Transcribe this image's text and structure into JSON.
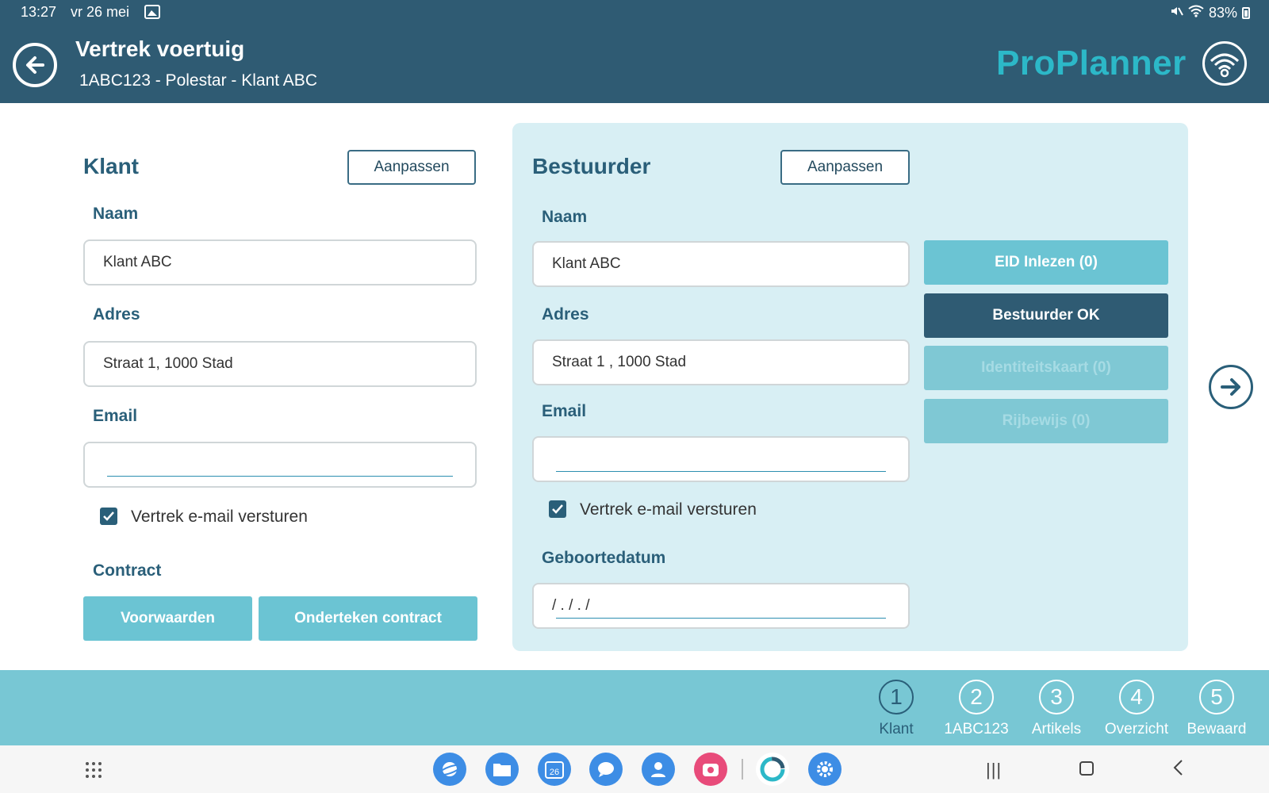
{
  "status_bar": {
    "time": "13:27",
    "date": "vr 26 mei",
    "battery": "83%"
  },
  "header": {
    "title": "Vertrek voertuig",
    "subtitle": "1ABC123 -  Polestar - Klant ABC",
    "logo": "ProPlanner",
    "logo_color": "#2cb8c8",
    "background": "#2f5b73"
  },
  "customer": {
    "title": "Klant",
    "edit_label": "Aanpassen",
    "name_label": "Naam",
    "name_value": "Klant ABC",
    "address_label": "Adres",
    "address_value": "Straat 1, 1000 Stad",
    "email_label": "Email",
    "email_value": "",
    "send_email_label": "Vertrek e-mail versturen",
    "send_email_checked": true,
    "contract_label": "Contract",
    "terms_button": "Voorwaarden",
    "sign_button": "Onderteken contract"
  },
  "driver": {
    "title": "Bestuurder",
    "edit_label": "Aanpassen",
    "name_label": "Naam",
    "name_value": "Klant ABC",
    "address_label": "Adres",
    "address_value": "Straat 1 , 1000 Stad",
    "email_label": "Email",
    "email_value": "",
    "send_email_label": "Vertrek e-mail versturen",
    "send_email_checked": true,
    "birthdate_label": "Geboortedatum",
    "birthdate_value": "/ . / . /",
    "eid_button": "EID Inlezen (0)",
    "ok_button": "Bestuurder OK",
    "id_card_button": "Identiteitskaart (0)",
    "license_button": "Rijbewijs (0)"
  },
  "steps": [
    {
      "number": "1",
      "label": "Klant",
      "active": true
    },
    {
      "number": "2",
      "label": "1ABC123",
      "active": false
    },
    {
      "number": "3",
      "label": "Artikels",
      "active": false
    },
    {
      "number": "4",
      "label": "Overzicht",
      "active": false
    },
    {
      "number": "5",
      "label": "Bewaard",
      "active": false
    }
  ],
  "nav_bar": {
    "calendar_day": "26",
    "apps": [
      "internet-icon",
      "files-icon",
      "calendar-icon",
      "messages-icon",
      "contacts-icon",
      "camera-icon",
      "proplanner-icon",
      "settings-icon"
    ]
  },
  "colors": {
    "accent": "#6bc4d3",
    "dark": "#2a5f79",
    "panel": "#d8eff4",
    "steps_bar": "#78c7d4"
  }
}
